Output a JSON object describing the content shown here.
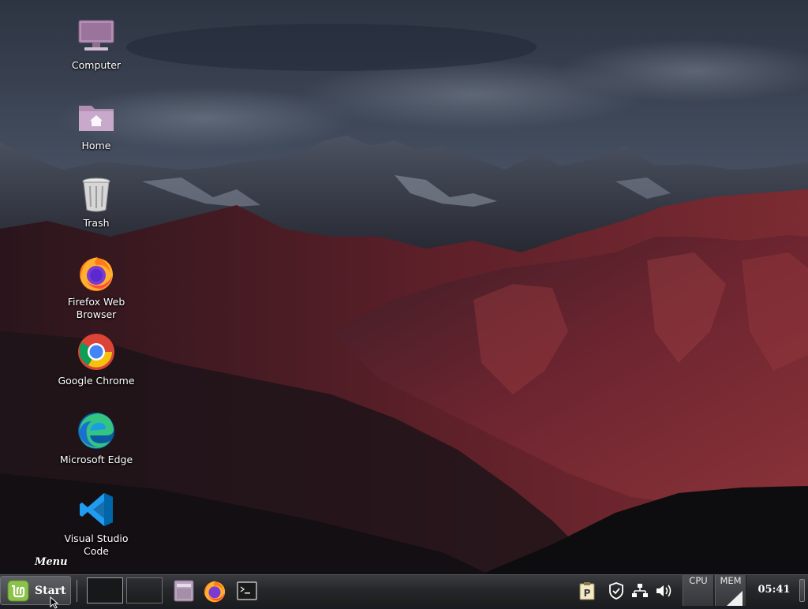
{
  "desktop": {
    "icons": [
      {
        "id": "computer",
        "label": "Computer",
        "icon": "computer-monitor-icon"
      },
      {
        "id": "home",
        "label": "Home",
        "icon": "home-folder-icon"
      },
      {
        "id": "trash",
        "label": "Trash",
        "icon": "trash-can-icon"
      },
      {
        "id": "firefox",
        "label": "Firefox Web\nBrowser",
        "icon": "firefox-icon"
      },
      {
        "id": "chrome",
        "label": "Google Chrome",
        "icon": "chrome-icon"
      },
      {
        "id": "edge",
        "label": "Microsoft Edge",
        "icon": "edge-icon"
      },
      {
        "id": "vscode",
        "label": "Visual Studio\nCode",
        "icon": "vscode-icon"
      }
    ]
  },
  "tooltip": {
    "text": "Menu"
  },
  "panel": {
    "start_label": "Start",
    "workspaces": [
      "workspace-1",
      "workspace-2"
    ],
    "launchers": [
      "file-manager-icon",
      "firefox-icon",
      "terminal-icon"
    ],
    "tray": [
      "clipboard-manager-icon",
      "update-shield-icon",
      "network-icon",
      "volume-icon"
    ],
    "cpu_label": "CPU",
    "mem_label": "MEM",
    "clock": "05:41"
  },
  "colors": {
    "panel_bg": "#26282b",
    "mint_green": "#8bc34a",
    "sky": "#3c4556",
    "mountain_red": "#7a2a30"
  }
}
